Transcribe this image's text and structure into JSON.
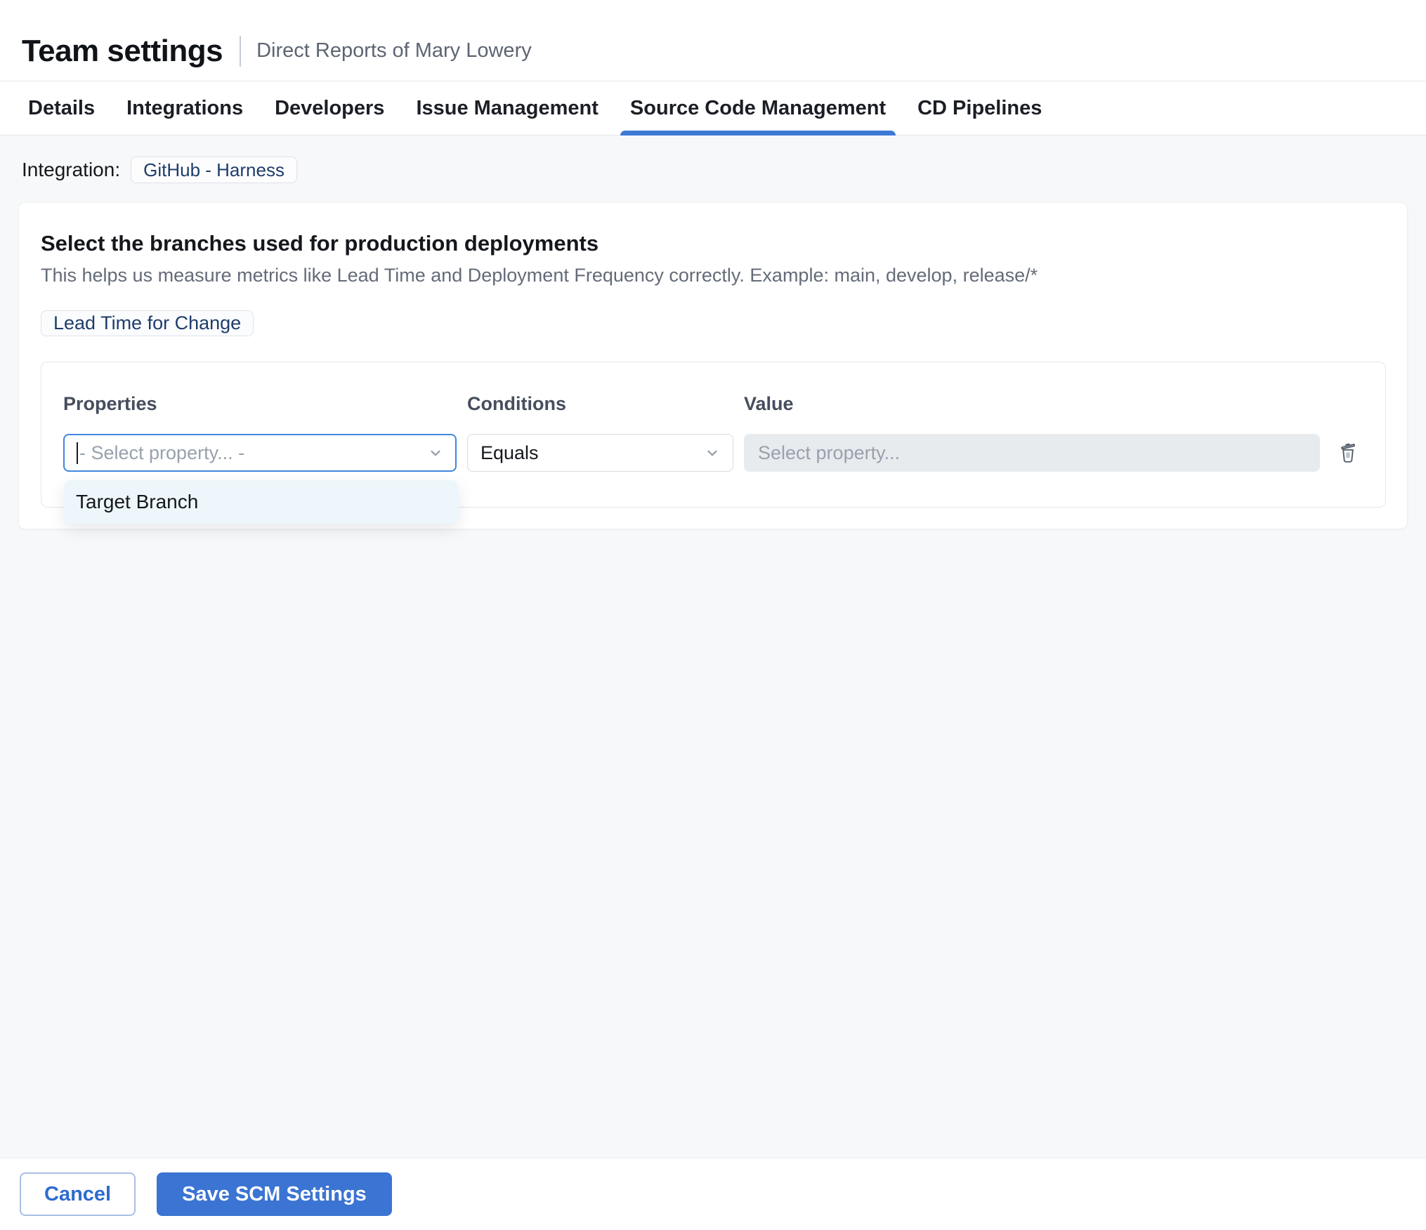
{
  "header": {
    "title": "Team settings",
    "subtitle": "Direct Reports of Mary Lowery"
  },
  "tabs": [
    {
      "label": "Details"
    },
    {
      "label": "Integrations"
    },
    {
      "label": "Developers"
    },
    {
      "label": "Issue Management"
    },
    {
      "label": "Source Code Management"
    },
    {
      "label": "CD Pipelines"
    }
  ],
  "integration": {
    "label": "Integration:",
    "value": "GitHub - Harness"
  },
  "card": {
    "heading": "Select the branches used for production deployments",
    "description": "This helps us measure metrics like Lead Time and Deployment Frequency correctly. Example: main, develop, release/*",
    "metric_chip": "Lead Time for Change"
  },
  "rule": {
    "columns": {
      "properties": "Properties",
      "conditions": "Conditions",
      "value": "Value"
    },
    "property_select": {
      "placeholder": "- Select property... -"
    },
    "condition_select": {
      "value": "Equals"
    },
    "value_input": {
      "placeholder": "Select property..."
    },
    "dropdown": {
      "options": [
        "Target Branch"
      ]
    }
  },
  "footer": {
    "cancel_label": "Cancel",
    "save_label": "Save SCM Settings"
  },
  "colors": {
    "accent_blue": "#3b74d2",
    "tab_underline": "#3d7ad6",
    "focus_border": "#4285e0",
    "chip_text_navy": "#1f3d6b",
    "page_background": "#f6f8f9",
    "dropdown_background": "#edf6fa",
    "disabled_input_background": "#e8ebee"
  }
}
